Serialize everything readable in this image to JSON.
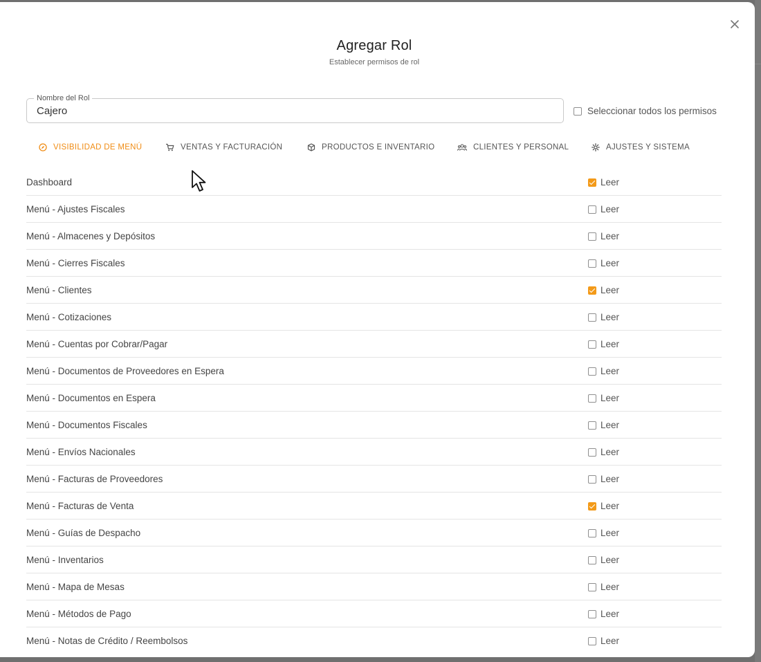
{
  "dialog": {
    "title": "Agregar Rol",
    "subtitle": "Establecer permisos de rol",
    "close_icon": "close-icon"
  },
  "role_name": {
    "label": "Nombre del Rol",
    "value": "Cajero"
  },
  "select_all": {
    "label": "Seleccionar todos los permisos",
    "checked": false
  },
  "colors": {
    "accent": "#f39a19",
    "active_tab": "#f08c14"
  },
  "tabs": [
    {
      "label": "VISIBILIDAD DE MENÚ",
      "icon": "compass-icon",
      "active": true
    },
    {
      "label": "VENTAS Y FACTURACIÓN",
      "icon": "cart-icon",
      "active": false
    },
    {
      "label": "PRODUCTOS E INVENTARIO",
      "icon": "box-icon",
      "active": false
    },
    {
      "label": "CLIENTES Y PERSONAL",
      "icon": "people-icon",
      "active": false
    },
    {
      "label": "AJUSTES Y SISTEMA",
      "icon": "gear-icon",
      "active": false
    }
  ],
  "permissions": [
    {
      "name": "Dashboard",
      "perm": "Leer",
      "checked": true
    },
    {
      "name": "Menú - Ajustes Fiscales",
      "perm": "Leer",
      "checked": false
    },
    {
      "name": "Menú - Almacenes y Depósitos",
      "perm": "Leer",
      "checked": false
    },
    {
      "name": "Menú - Cierres Fiscales",
      "perm": "Leer",
      "checked": false
    },
    {
      "name": "Menú - Clientes",
      "perm": "Leer",
      "checked": true
    },
    {
      "name": "Menú - Cotizaciones",
      "perm": "Leer",
      "checked": false
    },
    {
      "name": "Menú - Cuentas por Cobrar/Pagar",
      "perm": "Leer",
      "checked": false
    },
    {
      "name": "Menú - Documentos de Proveedores en Espera",
      "perm": "Leer",
      "checked": false
    },
    {
      "name": "Menú - Documentos en Espera",
      "perm": "Leer",
      "checked": false
    },
    {
      "name": "Menú - Documentos Fiscales",
      "perm": "Leer",
      "checked": false
    },
    {
      "name": "Menú - Envíos Nacionales",
      "perm": "Leer",
      "checked": false
    },
    {
      "name": "Menú - Facturas de Proveedores",
      "perm": "Leer",
      "checked": false
    },
    {
      "name": "Menú - Facturas de Venta",
      "perm": "Leer",
      "checked": true
    },
    {
      "name": "Menú - Guías de Despacho",
      "perm": "Leer",
      "checked": false
    },
    {
      "name": "Menú - Inventarios",
      "perm": "Leer",
      "checked": false
    },
    {
      "name": "Menú - Mapa de Mesas",
      "perm": "Leer",
      "checked": false
    },
    {
      "name": "Menú - Métodos de Pago",
      "perm": "Leer",
      "checked": false
    },
    {
      "name": "Menú - Notas de Crédito / Reembolsos",
      "perm": "Leer",
      "checked": false
    }
  ]
}
